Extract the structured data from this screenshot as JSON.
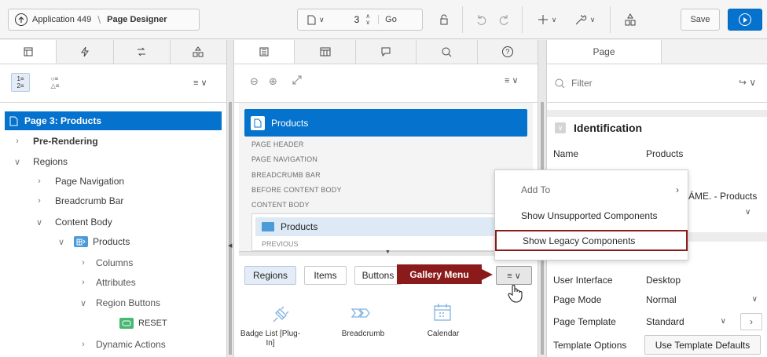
{
  "header": {
    "app_label": "Application 449",
    "page_designer": "Page Designer",
    "page_number": "3",
    "go_label": "Go",
    "save_label": "Save"
  },
  "left_pane": {
    "tree": {
      "page": "Page 3: Products",
      "pre_rendering": "Pre-Rendering",
      "regions": "Regions",
      "page_navigation": "Page Navigation",
      "breadcrumb_bar": "Breadcrumb Bar",
      "content_body": "Content Body",
      "products": "Products",
      "columns": "Columns",
      "attributes": "Attributes",
      "region_buttons": "Region Buttons",
      "reset": "RESET",
      "dynamic_actions": "Dynamic Actions"
    }
  },
  "middle_pane": {
    "layout": {
      "page_title": "Products",
      "labels": [
        "PAGE HEADER",
        "PAGE NAVIGATION",
        "BREADCRUMB BAR",
        "BEFORE CONTENT BODY",
        "CONTENT BODY"
      ],
      "region_title": "Products",
      "previous": "PREVIOUS"
    },
    "gallery": {
      "tabs": [
        "Regions",
        "Items",
        "Buttons"
      ],
      "callout": "Gallery Menu",
      "items": [
        "Badge List [Plug-In]",
        "Breadcrumb",
        "Calendar"
      ]
    }
  },
  "context_menu": {
    "items": [
      "Add To",
      "Show Unsupported Components",
      "Show Legacy Components"
    ]
  },
  "right_pane": {
    "tab": "Page",
    "filter_placeholder": "Filter",
    "section": "Identification",
    "name_label": "Name",
    "name_value": "Products",
    "title_partial": "ÁME. - Products",
    "properties": [
      {
        "label": "User Interface",
        "value": "Desktop"
      },
      {
        "label": "Page Mode",
        "value": "Normal"
      },
      {
        "label": "Page Template",
        "value": "Standard"
      },
      {
        "label": "Template Options",
        "value": "Use Template Defaults"
      }
    ]
  },
  "colors": {
    "accent": "#0572ce",
    "callout": "#8b1a1a",
    "highlight_border": "#8b1a1a"
  }
}
